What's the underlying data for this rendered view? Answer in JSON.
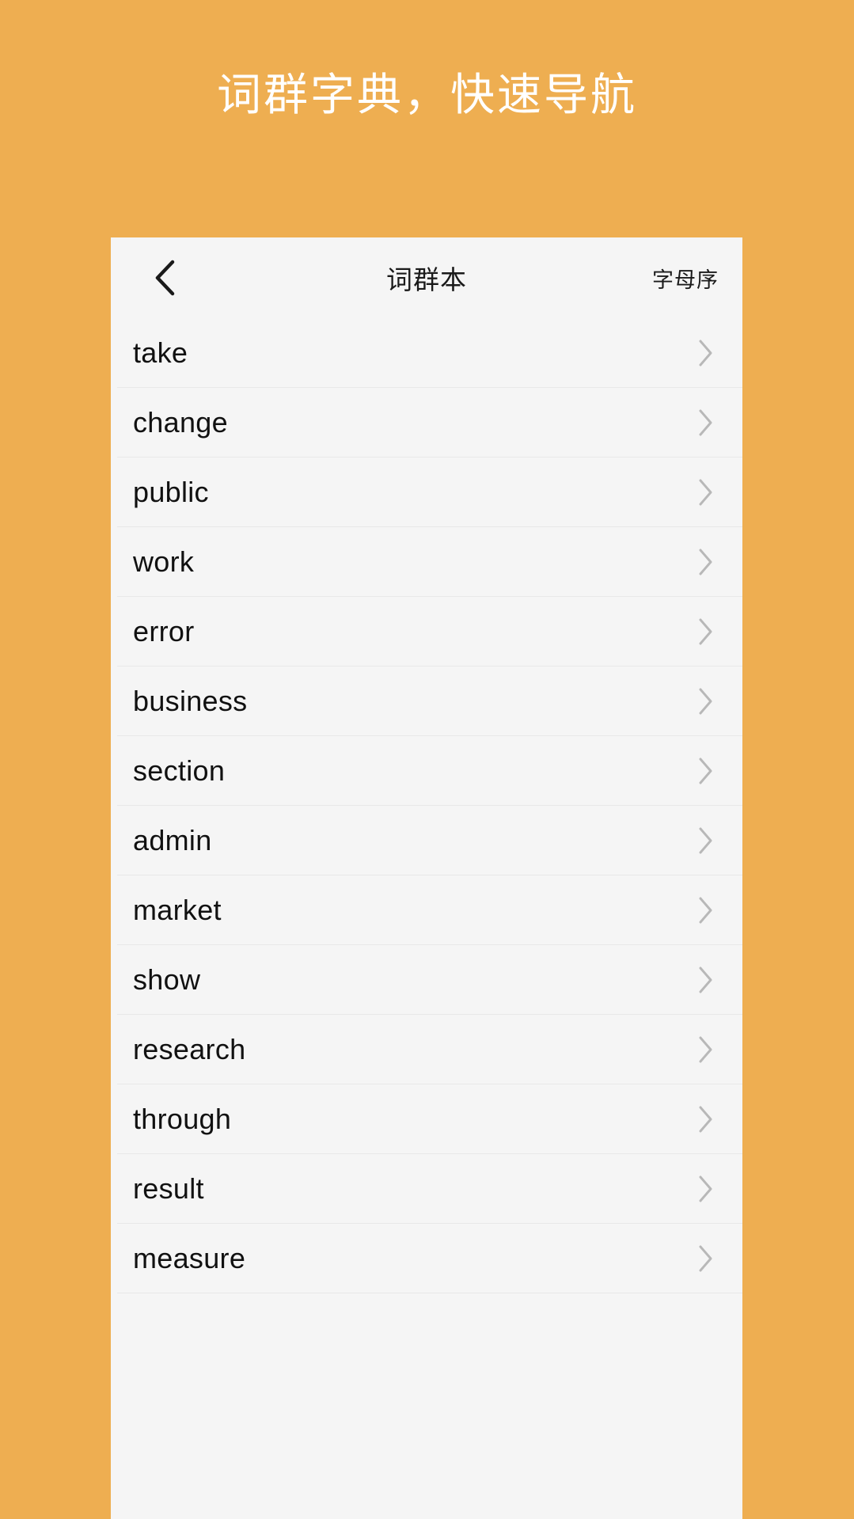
{
  "promo": {
    "headline": "词群字典，快速导航",
    "background_color": "#eeae51",
    "headline_color": "#ffffff"
  },
  "phone": {
    "screen_background": "#f5f5f5",
    "navbar": {
      "back_icon": "chevron-left-icon",
      "title": "词群本",
      "action_label": "字母序"
    },
    "list": {
      "chevron_icon": "chevron-right-icon",
      "items": [
        {
          "word": "take"
        },
        {
          "word": "change"
        },
        {
          "word": "public"
        },
        {
          "word": "work"
        },
        {
          "word": "error"
        },
        {
          "word": "business"
        },
        {
          "word": "section"
        },
        {
          "word": "admin"
        },
        {
          "word": "market"
        },
        {
          "word": "show"
        },
        {
          "word": "research"
        },
        {
          "word": "through"
        },
        {
          "word": "result"
        },
        {
          "word": "measure"
        }
      ]
    }
  }
}
